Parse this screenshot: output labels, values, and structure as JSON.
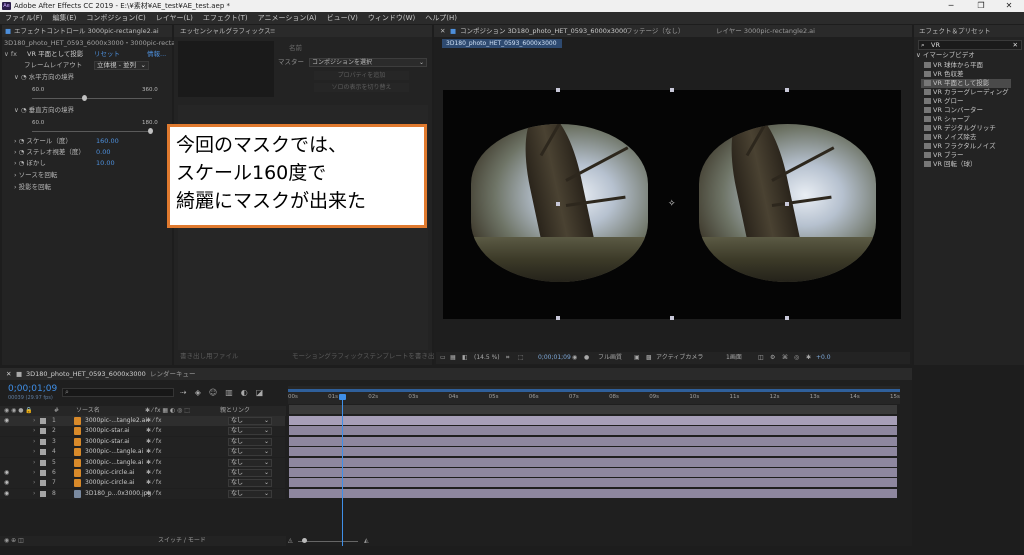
{
  "window": {
    "title": "Adobe After Effects CC 2019 - E:\\¥素材¥AE_test¥AE_test.aep *",
    "logo": "Ae"
  },
  "menu": [
    "ファイル(F)",
    "編集(E)",
    "コンポジション(C)",
    "レイヤー(L)",
    "エフェクト(T)",
    "アニメーション(A)",
    "ビュー(V)",
    "ウィンドウ(W)",
    "ヘルプ(H)"
  ],
  "effect_controls": {
    "tab_label": "エフェクトコントロール 3000pic-rectangle2.ai",
    "path": "3D180_photo_HET_0593_6000x3000・3000pic-rectangle2.ai",
    "effect_name": "VR 平面として投影",
    "reset": "リセット",
    "about": "情報...",
    "frame_layout_label": "フレームレイアウト",
    "frame_layout_value": "立体視 - 並列",
    "h_fov_label": "水平方向の境界",
    "h_min": "60.0",
    "h_max": "360.0",
    "v_fov_label": "垂直方向の境界",
    "v_min": "60.0",
    "v_max": "180.0",
    "scale_label": "スケール（度）",
    "scale_value": "160.00",
    "stereo_label": "ステレオ視差（度）",
    "stereo_value": "0.00",
    "blur_label": "ぼかし",
    "blur_value": "10.00",
    "source_rot_label": "ソースを回転",
    "proj_rot_label": "投影を回転"
  },
  "essential_graphics": {
    "tab_label": "エッセンシャルグラフィックス",
    "name_label": "名前",
    "master_label": "マスター",
    "master_value": "コンポジションを選択",
    "add_props_button": "プロパティを追加",
    "solo_button": "ソロの表示を切り替え",
    "footer_left": "書き出し用ファイル",
    "footer_right": "モーショングラフィックステンプレートを書き出し"
  },
  "callout": {
    "line1": "今回のマスクでは、",
    "line2": "スケール160度で",
    "line3": "綺麗にマスクが出来た"
  },
  "composition": {
    "tab_label": "コンポジション 3D180_photo_HET_0593_6000x3000",
    "footage_tab": "フッテージ（なし）",
    "layer_tab": "レイヤー 3000pic-rectangle2.ai",
    "sub_tab": "3D180_photo_HET_0593_6000x3000",
    "zoom": "(14.5 %)",
    "timecode": "0;00;01;09",
    "resolution": "フル画質",
    "camera": "アクティブカメラ",
    "views": "1画面",
    "exposure": "+0.0"
  },
  "effects_presets": {
    "tab_label": "エフェクト＆プリセット",
    "search_value": "VR",
    "category": "イマーシブビデオ",
    "items": [
      "VR 球体から平面",
      "VR 色収差",
      "VR 平面として投影",
      "VR カラーグレーディング",
      "VR グロー",
      "VR コンバーター",
      "VR シャープ",
      "VR デジタルグリッチ",
      "VR ノイズ除去",
      "VR フラクタルノイズ",
      "VR ブラー",
      "VR 回転（球）"
    ],
    "selected_index": 2
  },
  "timeline": {
    "tab_label": "3D180_photo_HET_0593_6000x3000",
    "render_tab": "レンダーキュー",
    "timecode": "0;00;01;09",
    "frame_info": "00039 (29.97 fps)",
    "search_placeholder": "",
    "col_source": "ソース名",
    "col_parent": "親とリンク",
    "ruler": [
      "00s",
      "01s",
      "02s",
      "03s",
      "04s",
      "05s",
      "06s",
      "07s",
      "08s",
      "09s",
      "10s",
      "11s",
      "12s",
      "13s",
      "14s",
      "15s"
    ],
    "playhead_seconds": 1.3,
    "duration_seconds": 15,
    "footer_toggle": "スイッチ / モード",
    "layers": [
      {
        "num": "1",
        "name": "3000pic-...tangle2.ai",
        "parent": "なし"
      },
      {
        "num": "2",
        "name": "3000pic-star.ai",
        "parent": "なし"
      },
      {
        "num": "3",
        "name": "3000pic-star.ai",
        "parent": "なし"
      },
      {
        "num": "4",
        "name": "3000pic-...tangle.ai",
        "parent": "なし"
      },
      {
        "num": "5",
        "name": "3000pic-...tangle.ai",
        "parent": "なし"
      },
      {
        "num": "6",
        "name": "3000pic-circle.ai",
        "parent": "なし"
      },
      {
        "num": "7",
        "name": "3000pic-circle.ai",
        "parent": "なし"
      },
      {
        "num": "8",
        "name": "3D180_p...0x3000.jpg",
        "parent": "なし"
      }
    ]
  }
}
